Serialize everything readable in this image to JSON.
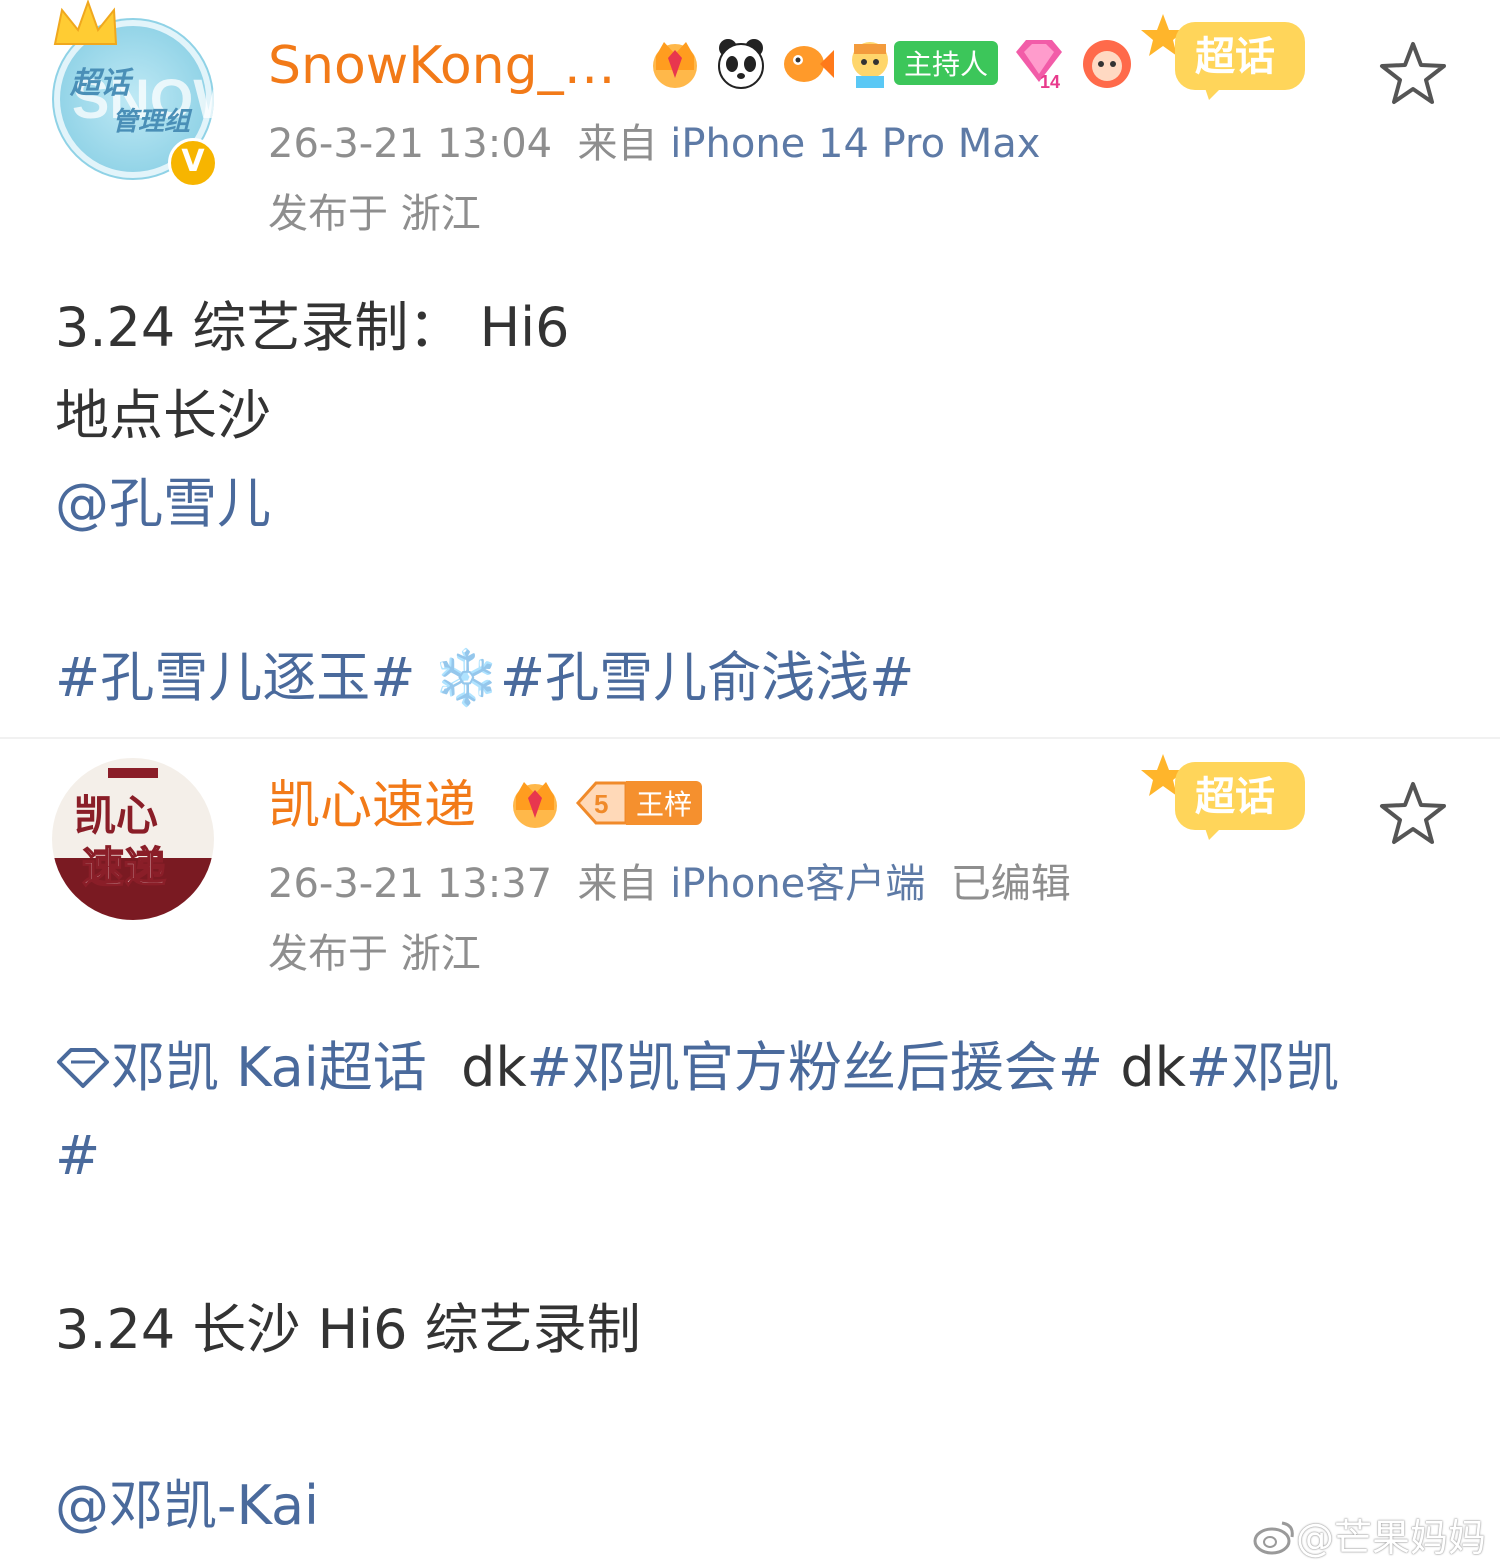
{
  "posts": [
    {
      "author": "SnowKong_…",
      "avatar_text": {
        "line1": "超话",
        "line2": "管理组",
        "big": "SNOW"
      },
      "verified_mark": "V",
      "badge_host_label": "主持人",
      "badge_level": "14",
      "chaohua_label": "超话",
      "time": "26-3-21 13:04",
      "source_prefix": "来自",
      "source": "iPhone 14 Pro Max",
      "edited": "",
      "location": "发布于 浙江",
      "content": {
        "line1": "3.24 综艺录制：  Hi6",
        "line2": "地点长沙",
        "mention": "@孔雪儿",
        "tag1": "#孔雪儿逐玉#",
        "emoji": "❄️",
        "tag2": "#孔雪儿俞浅浅#"
      }
    },
    {
      "author": "凯心速递",
      "avatar_text": {
        "line1": "凯心",
        "line2": "速递"
      },
      "badge_level": "5",
      "badge_name": "王梓",
      "chaohua_label": "超话",
      "time": "26-3-21 13:37",
      "source_prefix": "来自",
      "source": "iPhone客户端",
      "edited": "已编辑",
      "location": "发布于 浙江",
      "content": {
        "topic_link": "邓凯 Kai超话",
        "dk1": "dk",
        "tag1": "#邓凯官方粉丝后援会#",
        "dk2": "dk",
        "tag2a": "#邓凯",
        "tag2b": "#",
        "line_main": "3.24 长沙 Hi6 综艺录制",
        "mention": "@邓凯-Kai"
      }
    }
  ],
  "watermark": "@芒果妈妈",
  "colors": {
    "name": "#f27a18",
    "link": "#4a6a9c",
    "meta": "#8e8e8e",
    "text": "#333333"
  }
}
